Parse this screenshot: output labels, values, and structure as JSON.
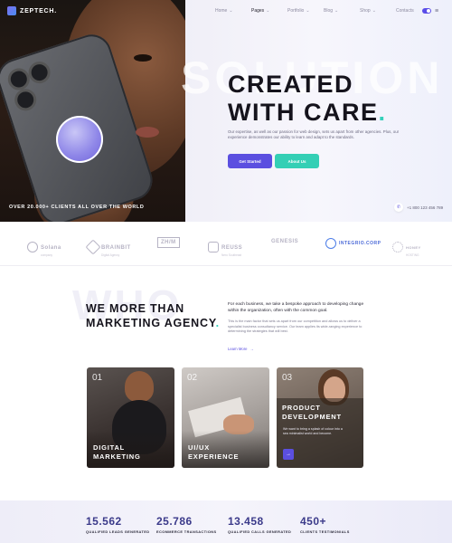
{
  "brand": {
    "name": "ZEPTECH."
  },
  "nav": {
    "items": [
      {
        "label": "Home",
        "active": false
      },
      {
        "label": "Pages",
        "active": true
      },
      {
        "label": "Portfolio",
        "active": false
      },
      {
        "label": "Blog",
        "active": false
      },
      {
        "label": "Shop",
        "active": false
      },
      {
        "label": "Contacts",
        "active": false
      }
    ]
  },
  "hero": {
    "watermark": "SOLUTION",
    "headline_line1": "CREATED",
    "headline_line2": "WITH CARE",
    "headline_dot": ".",
    "description": "Our expertise, as well as our passion for web design, sets us apart from other agencies. Plus, our experience demonstrates our ability to learn and adapt to the standards.",
    "primary_button": "Get Started",
    "secondary_button": "About Us",
    "clients_stat": "OVER 20.000+ CLIENTS ALL OVER THE WORLD",
    "phone": "+1 800 123 456 789"
  },
  "logos": [
    {
      "name": "Solana",
      "sub": "company"
    },
    {
      "name": "BRAINBIT",
      "sub": "Digital Agency"
    },
    {
      "name": "ZH/M",
      "sub": ""
    },
    {
      "name": "REUSS",
      "sub": "Nero Southeast"
    },
    {
      "name": "GENESIS",
      "sub": ""
    },
    {
      "name": "INTEGRIO.CORP",
      "sub": ""
    },
    {
      "name": "HONEY",
      "sub": "HOSTING"
    }
  ],
  "who": {
    "watermark": "WHO",
    "title_line1": "WE MORE THAN",
    "title_line2": "MARKETING AGENCY",
    "title_dot": ".",
    "lead": "For each business, we take a bespoke approach to developing change within the organization, often with the common goal.",
    "body": "This is the main factor that sets us apart from our competition and allows us to deliver a specialist business consultancy service. Our team applies its wide-ranging experience to determining the strategies that will best.",
    "learn_more": "Learn More"
  },
  "cards": [
    {
      "number": "01",
      "title_line1": "DIGITAL",
      "title_line2": "MARKETING"
    },
    {
      "number": "02",
      "title_line1": "UI/UX",
      "title_line2": "EXPERIENCE"
    },
    {
      "number": "03",
      "title_line1": "PRODUCT",
      "title_line2": "DEVELOPMENT",
      "description": "We want to bring a splash of colour into a sea minimalist world and become."
    }
  ],
  "stats": [
    {
      "value": "15.562",
      "label": "QUALIFIED LEADS GENERATED"
    },
    {
      "value": "25.786",
      "label": "ECOMMERCE TRANSACTIONS"
    },
    {
      "value": "13.458",
      "label": "QUALIFIED CALLS GENERATED"
    },
    {
      "value": "450+",
      "label": "CLIENTS TESTIMONIALS"
    }
  ],
  "colors": {
    "accent": "#5b4fe0",
    "teal": "#34cfb5",
    "dark": "#15131c"
  }
}
